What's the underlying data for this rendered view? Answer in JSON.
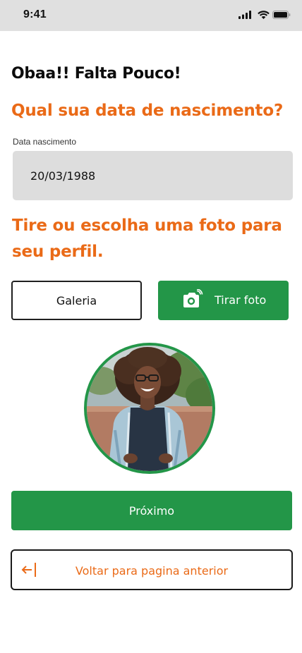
{
  "status_bar": {
    "time": "9:41",
    "icons": [
      "signal-icon",
      "wifi-icon",
      "battery-icon"
    ]
  },
  "heading": "Obaa!! Falta Pouco!",
  "birth_question": "Qual sua data de nascimento?",
  "birth_field": {
    "label": "Data  nascimento",
    "value": "20/03/1988"
  },
  "photo_prompt": "Tire ou escolha uma foto para seu perfil.",
  "buttons": {
    "gallery": "Galeria",
    "take_photo": "Tirar foto",
    "next": "Próximo",
    "back": "Voltar para pagina anterior"
  },
  "colors": {
    "accent_orange": "#ea6a17",
    "primary_green": "#239648",
    "field_bg": "#dddddd",
    "status_bar_bg": "#e0e0e0"
  }
}
